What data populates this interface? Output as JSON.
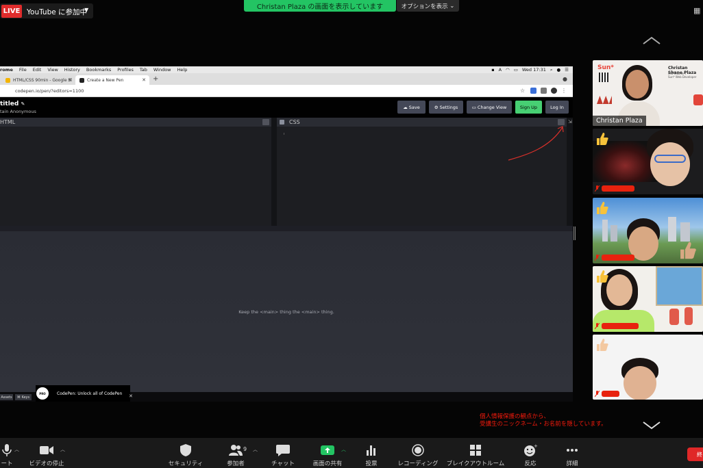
{
  "top": {
    "live_badge": "LIVE",
    "youtube_label": "YouTube に参加中",
    "share_banner": "Christan Plaza の画面を表示しています",
    "options_label": "オプションを表示"
  },
  "mac_menu": [
    "rome",
    "File",
    "Edit",
    "View",
    "History",
    "Bookmarks",
    "Profiles",
    "Tab",
    "Window",
    "Help"
  ],
  "mac_clock": "Wed 17:31",
  "browser": {
    "tabs": [
      {
        "title": "HTML/CSS 90min - Google Sl",
        "color": "#f4b400"
      },
      {
        "title": "Create a New Pen",
        "color": "#222222"
      }
    ],
    "url": "codepen.io/pen/?editors=1100"
  },
  "codepen": {
    "title": "titled",
    "author": "tain Anonymous",
    "buttons": {
      "save": "Save",
      "settings": "Settings",
      "change_view": "Change View",
      "sign_up": "Sign Up",
      "log_in": "Log In"
    },
    "editors": {
      "html": "HTML",
      "css": "CSS"
    },
    "result_message": "Keep the <main> thing the <main> thing.",
    "footer": {
      "assets": "Assets",
      "keys": "⌘ Keys"
    },
    "pro_logo": "PRO",
    "pro_promo": "CodePen: Unlock all of CodePen"
  },
  "participants": [
    {
      "name": "Christan Plaza",
      "slide_brand": "Sun*",
      "slide_name": "Christan Shane Plaza",
      "slide_role_1": "Mid Teacher /",
      "slide_role_2": "Sun* Web Developer"
    },
    {
      "name": ""
    },
    {
      "name": ""
    },
    {
      "name": ""
    },
    {
      "name": ""
    }
  ],
  "privacy_notice": {
    "line1": "個人情報保護の観点から、",
    "line2": "受講生のニックネーム・お名前を隠しています。"
  },
  "toolbar": {
    "audio": "ート",
    "video": "ビデオの停止",
    "security": "セキュリティ",
    "participants": "参加者",
    "participants_count": "9",
    "chat": "チャット",
    "share": "画面の共有",
    "poll": "投票",
    "record": "レコーディング",
    "breakout": "ブレイクアウトルーム",
    "reactions": "反応",
    "more": "詳細",
    "end": "終"
  },
  "colors": {
    "live_red": "#e02c2c",
    "share_green": "#23c463",
    "codepen_green": "#47cf73",
    "notice_red": "#f21a0c"
  }
}
